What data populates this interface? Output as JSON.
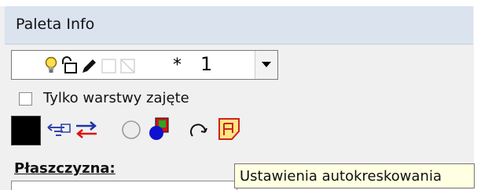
{
  "panel": {
    "title": "Paleta Info"
  },
  "layer": {
    "icons": [
      "lightbulb-icon",
      "lock-icon",
      "pencil-icon",
      "color-box-icon",
      "hatch-box-icon"
    ],
    "star": "*",
    "number": "1"
  },
  "only_occupied": {
    "label": "Tylko warstwy zajęte",
    "checked": false
  },
  "toolbar": {
    "color": "#000000",
    "buttons": [
      "color-swatch",
      "pointing-hand-icon",
      "swap-arrows-icon",
      "circle-icon",
      "color-shapes-icon",
      "rotate-icon",
      "autohatch-icon"
    ]
  },
  "plane": {
    "label": "Płaszczyzna:",
    "value": ""
  },
  "tooltip": {
    "text": "Ustawienia autokreskowania"
  }
}
